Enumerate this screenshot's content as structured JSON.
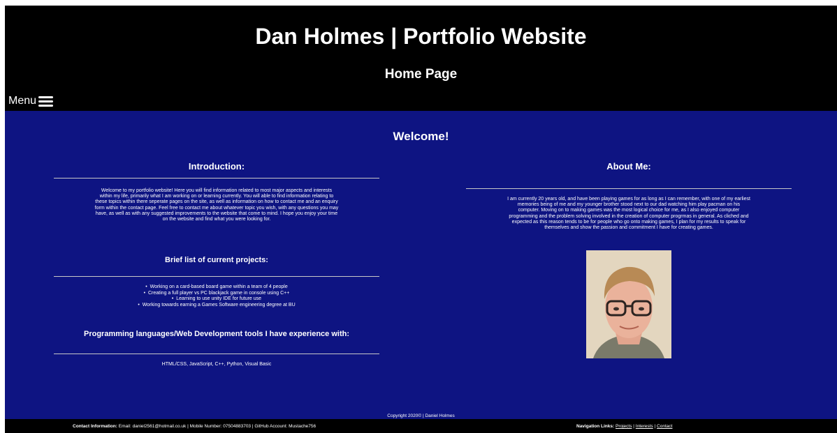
{
  "header": {
    "site_title": "Dan Holmes | Portfolio Website",
    "page_subtitle": "Home Page",
    "menu_label": "Menu",
    "menu_icon": "hamburger-icon"
  },
  "main": {
    "welcome": "Welcome!",
    "intro": {
      "heading": "Introduction:",
      "text": "Welcome to my portfolio website! Here you will find information related to most major aspects and interests within my life, primarily what I am working on or learning currently. You will able to find information relating to these topics within there seperate pages on the site, as well as information on how to contact me and an enquiry form within the contact page. Feel free to contact me about whatever topic you wish, with any questions you may have, as well as with any suggested improvements to the website that come to mind. I hope you enjoy your time on the website and find what you were looking for."
    },
    "projects": {
      "heading": "Brief list of current projects:",
      "items": [
        "Working on a card-based board game within a team of 4 people",
        "Creating a full player vs PC blackjack game in console using C++",
        "Learning to use unity IDE for future use",
        "Working towards earning a Games Software engineering degree at BU"
      ]
    },
    "tools": {
      "heading": "Programming languages/Web Development tools I have experience with:",
      "text": "HTML/CSS, JavaScript, C++, Python, Visual Basic"
    },
    "about": {
      "heading": "About Me:",
      "text": "I am currently 20 years old, and have been playing games for as long as I can remember, with one of my earliest memories being of me and my younger brother stood next to our dad watching him play pacman on his computer. Moving on to making games was the most logical choice for me, as I also enjoyed computer programming and the problem solving involved in the creation of computer progrmas in general. As cliched and expected as this reason tends to be for people who go onto making games, I plan for my results to speak for themselves and show the passion and commitment I have for creating games."
    },
    "copyright": "Copyright 2020© | Daniel Holmes"
  },
  "footer": {
    "contact_label": "Contact Information:",
    "contact_text": " Email: daniel2561@hotmail.co.uk | Mobile Number: 07504883703 | GitHub Account: Mustache756",
    "nav_label": "Navigation Links:",
    "nav_links": [
      "Projects",
      "Interests",
      "Contact"
    ],
    "nav_separator": " | "
  },
  "colors": {
    "header_bg": "#000000",
    "main_bg": "#0e1482",
    "text": "#ffffff"
  }
}
